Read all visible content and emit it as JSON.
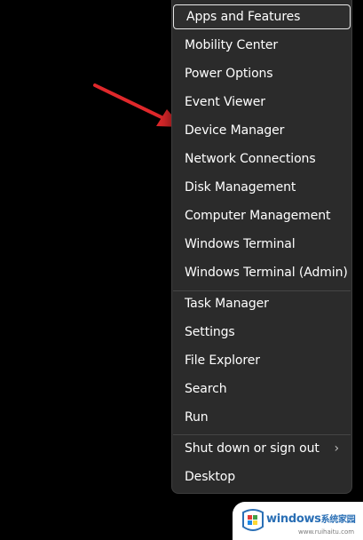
{
  "menu": {
    "group1": [
      {
        "label": "Apps and Features",
        "key": "apps"
      },
      {
        "label": "Mobility Center",
        "key": "mobility"
      },
      {
        "label": "Power Options",
        "key": "power"
      },
      {
        "label": "Event Viewer",
        "key": "event"
      },
      {
        "label": "Device Manager",
        "key": "device"
      },
      {
        "label": "Network Connections",
        "key": "network"
      },
      {
        "label": "Disk Management",
        "key": "disk"
      },
      {
        "label": "Computer Management",
        "key": "computer"
      },
      {
        "label": "Windows Terminal",
        "key": "terminal"
      },
      {
        "label": "Windows Terminal (Admin)",
        "key": "terminal-admin"
      }
    ],
    "group2": [
      {
        "label": "Task Manager",
        "key": "task"
      },
      {
        "label": "Settings",
        "key": "settings"
      },
      {
        "label": "File Explorer",
        "key": "explorer"
      },
      {
        "label": "Search",
        "key": "search"
      },
      {
        "label": "Run",
        "key": "run"
      }
    ],
    "group3": [
      {
        "label": "Shut down or sign out",
        "key": "shutdown",
        "has_submenu": true
      },
      {
        "label": "Desktop",
        "key": "desktop"
      }
    ],
    "focused_item": "Apps and Features",
    "chevron_icon": "chevron-right-icon"
  },
  "annotation": {
    "arrow_color": "#e0282b",
    "points_to": "Device Manager"
  },
  "watermark": {
    "brand": "windows",
    "brand_cn": "系统家园",
    "url": "www.ruihaitu.com"
  },
  "colors": {
    "background": "#000000",
    "menu_bg": "#2b2b2b",
    "text": "#ffffff",
    "focus_border": "#e8e8e8",
    "separator": "#454545"
  }
}
